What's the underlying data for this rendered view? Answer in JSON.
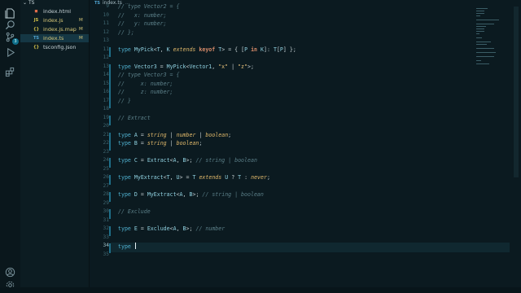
{
  "sidebar": {
    "section_title": "TS",
    "files": [
      {
        "icon_text": "◼",
        "icon_color": "#e06c4a",
        "name": "index.html",
        "status": ""
      },
      {
        "icon_text": "JS",
        "icon_color": "#d8c54a",
        "name": "index.js",
        "status": "M"
      },
      {
        "icon_text": "{}",
        "icon_color": "#d8c54a",
        "name": "index.js.map",
        "status": "M"
      },
      {
        "icon_text": "TS",
        "icon_color": "#4fa3d1",
        "name": "index.ts",
        "status": "M",
        "active": true
      },
      {
        "icon_text": "{}",
        "icon_color": "#d8c54a",
        "name": "tsconfig.json",
        "status": ""
      }
    ],
    "scm_badge": "3"
  },
  "tab": {
    "lang": "TS",
    "name": "index.ts",
    "more": "..."
  },
  "editor": {
    "current_line": 34,
    "lines": [
      {
        "n": 9,
        "text": "// type Vector2 = {"
      },
      {
        "n": 10,
        "text": "//   x: number;"
      },
      {
        "n": 11,
        "text": "//   y: number;"
      },
      {
        "n": 12,
        "text": "// };"
      },
      {
        "n": 13,
        "text": ""
      },
      {
        "n": 11,
        "text": "type MyPick<T, K extends keyof T> = { [P in K]: T[P] };"
      },
      {
        "n": 12,
        "text": ""
      },
      {
        "n": 13,
        "text": "type Vector3 = MyPick<Vector1, \"x\" | \"z\">;"
      },
      {
        "n": 14,
        "text": "// type Vector3 = {"
      },
      {
        "n": 15,
        "text": "//     x: number;"
      },
      {
        "n": 16,
        "text": "//     z: number;"
      },
      {
        "n": 17,
        "text": "// }"
      },
      {
        "n": 18,
        "text": ""
      },
      {
        "n": 19,
        "text": "// Extract"
      },
      {
        "n": 20,
        "text": ""
      },
      {
        "n": 21,
        "text": "type A = string | number | boolean;"
      },
      {
        "n": 22,
        "text": "type B = string | boolean;"
      },
      {
        "n": 23,
        "text": ""
      },
      {
        "n": 24,
        "text": "type C = Extract<A, B>; // string | boolean"
      },
      {
        "n": 25,
        "text": ""
      },
      {
        "n": 26,
        "text": "type MyExtract<T, U> = T extends U ? T : never;"
      },
      {
        "n": 27,
        "text": ""
      },
      {
        "n": 28,
        "text": "type D = MyExtract<A, B>; // string | boolean"
      },
      {
        "n": 29,
        "text": ""
      },
      {
        "n": 30,
        "text": "// Exclude"
      },
      {
        "n": 31,
        "text": ""
      },
      {
        "n": 32,
        "text": "type E = Exclude<A, B>; // number"
      },
      {
        "n": 33,
        "text": ""
      },
      {
        "n": 34,
        "text": "type "
      },
      {
        "n": 35,
        "text": ""
      }
    ]
  },
  "colors": {
    "background": "#0b1a20",
    "accent": "#1f6f89"
  }
}
